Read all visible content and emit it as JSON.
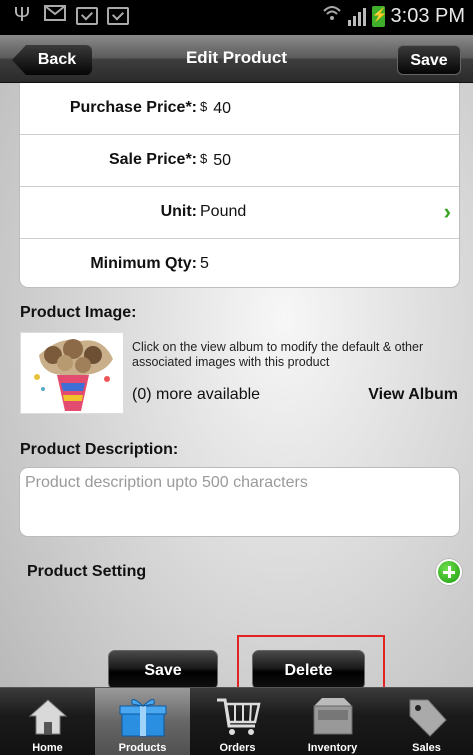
{
  "status_bar": {
    "time": "3:03 PM",
    "icons": [
      "usb-icon",
      "email-icon",
      "checkbox-icon",
      "checkbox-icon",
      "wifi-icon",
      "signal-icon",
      "battery-charging-icon"
    ]
  },
  "header": {
    "back_label": "Back",
    "title": "Edit Product",
    "save_label": "Save"
  },
  "form": {
    "purchase_price": {
      "label": "Purchase Price*:",
      "currency": "$",
      "value": "40"
    },
    "sale_price": {
      "label": "Sale Price*:",
      "currency": "$",
      "value": "50"
    },
    "unit": {
      "label": "Unit:",
      "value": "Pound"
    },
    "minimum_qty": {
      "label": "Minimum Qty:",
      "value": "5"
    }
  },
  "product_image": {
    "label": "Product Image:",
    "help_text": "Click on the view album to modify the default & other associated images with this product",
    "more_available": "(0) more available",
    "view_album_label": "View Album"
  },
  "product_description": {
    "label": "Product Description:",
    "placeholder": "Product description upto 500 characters"
  },
  "product_setting": {
    "label": "Product Setting"
  },
  "actions": {
    "save_label": "Save",
    "delete_label": "Delete"
  },
  "tabs": [
    {
      "label": "Home",
      "icon": "home-icon",
      "active": false
    },
    {
      "label": "Products",
      "icon": "gift-icon",
      "active": true
    },
    {
      "label": "Orders",
      "icon": "cart-icon",
      "active": false
    },
    {
      "label": "Inventory",
      "icon": "inventory-box-icon",
      "active": false
    },
    {
      "label": "Sales",
      "icon": "tag-icon",
      "active": false
    }
  ],
  "colors": {
    "accent_green": "#3aa320",
    "highlight_red": "#e32222"
  }
}
